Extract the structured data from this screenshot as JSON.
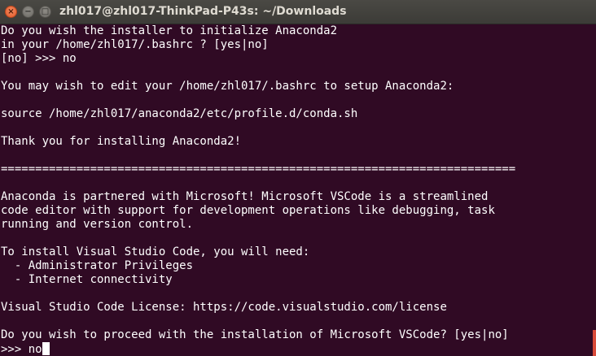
{
  "window": {
    "title": "zhl017@zhl017-ThinkPad-P43s: ~/Downloads",
    "controls": {
      "close_glyph": "×",
      "minimize_glyph": "−",
      "maximize_glyph": "□"
    }
  },
  "terminal": {
    "lines": [
      "Do you wish the installer to initialize Anaconda2",
      "in your /home/zhl017/.bashrc ? [yes|no]",
      "[no] >>> no",
      "",
      "You may wish to edit your /home/zhl017/.bashrc to setup Anaconda2:",
      "",
      "source /home/zhl017/anaconda2/etc/profile.d/conda.sh",
      "",
      "Thank you for installing Anaconda2!",
      "",
      "===========================================================================",
      "",
      "Anaconda is partnered with Microsoft! Microsoft VSCode is a streamlined",
      "code editor with support for development operations like debugging, task",
      "running and version control.",
      "",
      "To install Visual Studio Code, you will need:",
      "  - Administrator Privileges",
      "  - Internet connectivity",
      "",
      "Visual Studio Code License: https://code.visualstudio.com/license",
      "",
      "Do you wish to proceed with the installation of Microsoft VSCode? [yes|no]"
    ],
    "prompt_line": ">>> no",
    "colors": {
      "background": "#300a24",
      "foreground": "#ffffff",
      "close_button": "#e05a2b",
      "scroll_indicator": "#d94b3a"
    }
  }
}
